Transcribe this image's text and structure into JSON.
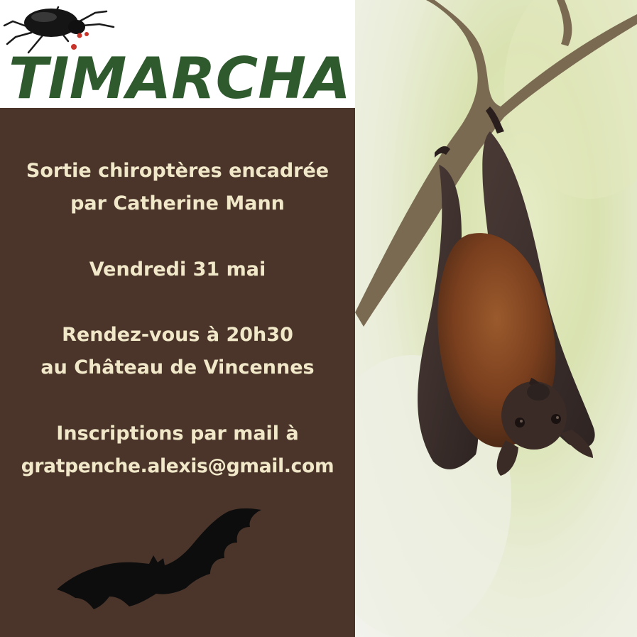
{
  "logo": {
    "text": "TIMARCHA",
    "text_color": "#2f5a2e",
    "beetle_icon": "beetle-icon"
  },
  "panel": {
    "background": "#4b352b",
    "text_color": "#f0e8c8",
    "title_line1": "Sortie chiroptères encadrée",
    "title_line2": "par Catherine Mann",
    "date": "Vendredi 31 mai",
    "meeting_line1": "Rendez-vous à 20h30",
    "meeting_line2": "au Château de Vincennes",
    "signup_line1": "Inscriptions par mail à",
    "signup_email": "gratpenche.alexis@gmail.com",
    "silhouette_icon": "bat-silhouette-icon"
  },
  "photo": {
    "subject_icon": "hanging-fruit-bat"
  }
}
